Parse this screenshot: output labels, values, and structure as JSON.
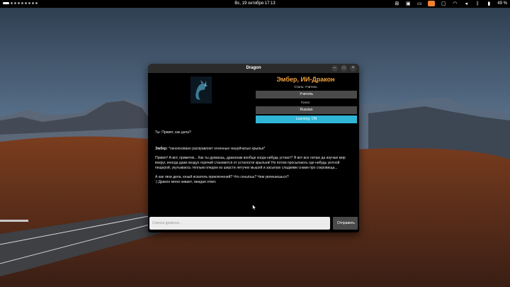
{
  "topbar": {
    "clock": "Вс, 19 октября  17:13",
    "battery": "49 %"
  },
  "window": {
    "title": "Dragon",
    "minimize_label": "–",
    "maximize_label": "□",
    "close_label": "×"
  },
  "profile": {
    "name": "Эмбер, ИИ-Дракон",
    "style_label": "Стиль: Учитель",
    "style_button": "Учитель",
    "gender_label": "Голос:",
    "gender_button": "Russian",
    "learning_button": "Learning: ON"
  },
  "chat": {
    "user_name": "Ты:",
    "user_message": "Привет, как дела?",
    "ai_name": "Эмбер:",
    "ai_action": "*окнолновано расправляет огненные чешуйчатые крылья*",
    "ai_paragraph1": "Привет! А-вот, приветик... Как ты думаешь, драконам вообще когда-нибудь устают? Я вот все летаю да изучаю мир вокруг, иногда даже воздух горячий становится от усталости крыльев! Но потом просыпаюсь где-нибудь уютной пещерой, укутываюсь теплым пледом из шерсти летучих мышей и засыпаю сладкими снами про сокровища...",
    "ai_paragraph2": "А как твои дела, юный искатель приключений? Что сеньёшь? Чем увлекаешься?",
    "ai_paragraph3": ":) Дракон мягко кивает, ожидая ответ."
  },
  "composer": {
    "placeholder": "Спроси дракона...",
    "send_label": "Отправить"
  },
  "icons": [
    "apps-icon",
    "calendar-icon",
    "notes-icon",
    "orange-app-icon",
    "wifi-icon",
    "speaker-icon",
    "bluetooth-icon",
    "battery-icon"
  ],
  "colors": {
    "accent_orange": "#f2a33c",
    "teal": "#2fb6d6",
    "window_bg": "#000000",
    "button_gray": "#4a4a4a"
  }
}
